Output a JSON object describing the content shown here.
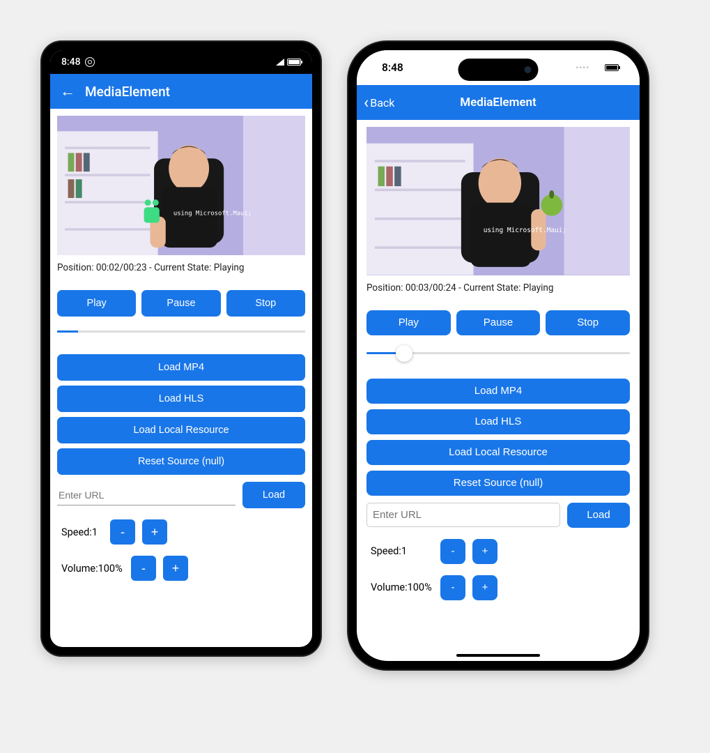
{
  "accent": "#1976E8",
  "android": {
    "status": {
      "time": "8:48"
    },
    "appbar": {
      "title": "MediaElement"
    },
    "player": {
      "position_line": "Position: 00:02/00:23 - Current State: Playing",
      "position": "00:02",
      "duration": "00:23",
      "state": "Playing"
    },
    "controls": {
      "play": "Play",
      "pause": "Pause",
      "stop": "Stop"
    },
    "loaders": {
      "mp4": "Load MP4",
      "hls": "Load HLS",
      "local": "Load Local Resource",
      "reset": "Reset Source (null)"
    },
    "url": {
      "placeholder": "Enter URL",
      "load": "Load"
    },
    "speed": {
      "label": "Speed:",
      "value": "1",
      "minus": "-",
      "plus": "+"
    },
    "volume": {
      "label": "Volume:",
      "value": "100%",
      "minus": "-",
      "plus": "+"
    },
    "shirt_text": "using Microsoft.Maui;"
  },
  "ios": {
    "status": {
      "time": "8:48"
    },
    "appbar": {
      "back": "Back",
      "title": "MediaElement"
    },
    "player": {
      "position_line": "Position: 00:03/00:24 - Current State: Playing",
      "position": "00:03",
      "duration": "00:24",
      "state": "Playing"
    },
    "controls": {
      "play": "Play",
      "pause": "Pause",
      "stop": "Stop"
    },
    "loaders": {
      "mp4": "Load MP4",
      "hls": "Load HLS",
      "local": "Load Local Resource",
      "reset": "Reset Source (null)"
    },
    "url": {
      "placeholder": "Enter URL",
      "load": "Load"
    },
    "speed": {
      "label": "Speed:",
      "value": "1",
      "minus": "-",
      "plus": "+"
    },
    "volume": {
      "label": "Volume:",
      "value": "100%",
      "minus": "-",
      "plus": "+"
    },
    "shirt_text": "using Microsoft.Maui;"
  }
}
